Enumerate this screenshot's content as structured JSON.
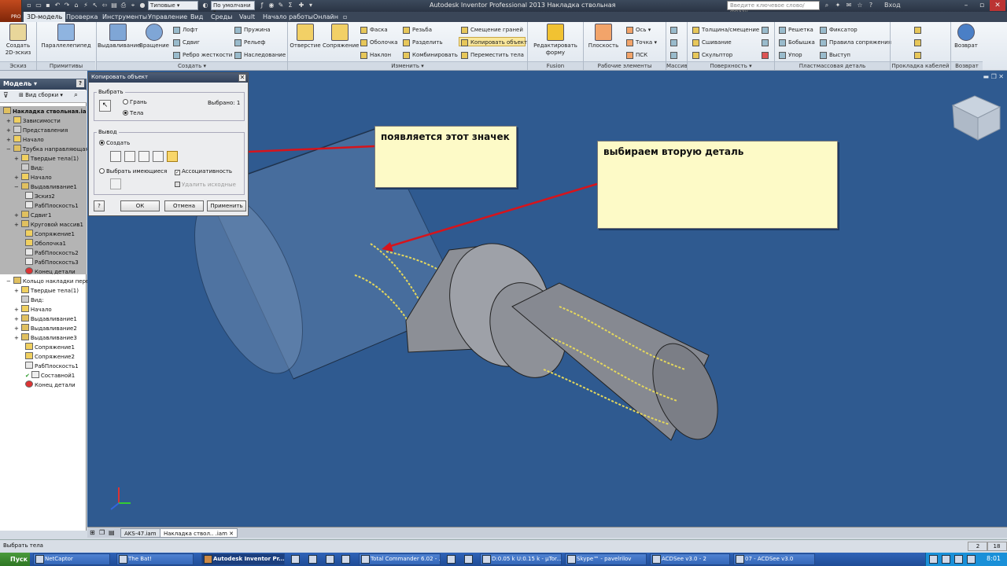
{
  "window": {
    "title": "Autodesk Inventor Professional 2013   Накладка ствольная",
    "app_badge": "PRO",
    "search_placeholder": "Введите ключевое слово/фразу",
    "login": "Вход"
  },
  "quick_access": {
    "style_select": "Типовые",
    "view_select": "По умолчани"
  },
  "menu_tabs": [
    "3D-модель",
    "Проверка",
    "Инструменты",
    "Управление",
    "Вид",
    "Среды",
    "Vault",
    "Начало работы",
    "Онлайн"
  ],
  "ribbon": {
    "sketch": {
      "create_2d_sketch": "Создать 2D-эскиз",
      "label": "Эскиз"
    },
    "primitives": {
      "box": "Параллелепипед",
      "label": "Примитивы"
    },
    "create": {
      "extrude": "Выдавливание",
      "revolve": "Вращение",
      "loft": "Лофт",
      "sweep": "Сдвиг",
      "rib": "Ребро жесткости",
      "coil": "Пружина",
      "emboss": "Рельеф",
      "derive": "Наследование",
      "label": "Создать"
    },
    "modify": {
      "hole": "Отверстие",
      "fillet": "Сопряжение",
      "chamfer": "Фаска",
      "shell": "Оболочка",
      "draft": "Наклон",
      "thread": "Резьба",
      "split": "Разделить",
      "combine": "Комбинировать",
      "offset_faces": "Смещение граней",
      "copy_object": "Копировать объект",
      "move_bodies": "Переместить тела",
      "label": "Изменить"
    },
    "fusion": {
      "edit_form": "Редактировать форму",
      "label": "Fusion"
    },
    "work_features": {
      "plane": "Плоскость",
      "axis": "Ось",
      "point": "Точка",
      "ucs": "ПСК",
      "label": "Рабочие элементы"
    },
    "pattern": {
      "label": "Массив"
    },
    "surface": {
      "thicken": "Толщина/смещение",
      "stitch": "Сшивание",
      "sculpt": "Скульптор",
      "label": "Поверхность"
    },
    "plastic": {
      "grill": "Решетка",
      "boss": "Бобышка",
      "rest": "Упор",
      "snap_fit": "Фиксатор",
      "rule_fillet": "Правила сопряжения",
      "lip": "Выступ",
      "label": "Пластмассовая деталь"
    },
    "harness": {
      "label": "Прокладка кабелей"
    },
    "return": {
      "button": "Возврат",
      "label": "Возврат"
    }
  },
  "browser": {
    "header": "Модель",
    "view_select": "Вид сборки",
    "items": [
      "Накладка ствольная.ia",
      "Зависимости",
      "Представления",
      "Начало",
      "Трубка направляющая",
      "Твердые тела(1)",
      "Вид:",
      "Начало",
      "Выдавливание1",
      "Эскиз2",
      "РабПлоскость1",
      "Сдвиг1",
      "Круговой массив1",
      "Сопряжение1",
      "Оболочка1",
      "РабПлоскость2",
      "РабПлоскость3",
      "Конец детали",
      "Кольцо накладки пере",
      "Твердые тела(1)",
      "Вид:",
      "Начало",
      "Выдавливание1",
      "Выдавливание2",
      "Выдавливание3",
      "Сопряжение1",
      "Сопряжение2",
      "РабПлоскость1",
      "Составной1",
      "Конец детали"
    ]
  },
  "dialog": {
    "title": "Копировать объект",
    "select_group": "Выбрать",
    "face": "Грань",
    "bodies": "Тела",
    "selected": "Выбрано: 1",
    "output_group": "Вывод",
    "create": "Создать",
    "select_existing": "Выбрать имеющиеся",
    "associative": "Ассоциативность",
    "delete_originals": "Удалить исходные",
    "ok": "ОК",
    "cancel": "Отмена",
    "apply": "Применить",
    "help": "?"
  },
  "callouts": {
    "first": "появляется этот значек",
    "second": "выбираем вторую деталь"
  },
  "doc_tabs": [
    "AKS-47.iam",
    "Накладка ствол.. .iam"
  ],
  "status": {
    "text": "Выбрать тела",
    "num1": "2",
    "num2": "18"
  },
  "taskbar": {
    "start": "Пуск",
    "items": [
      "NetCaptor",
      "The Bat!",
      "Autodesk Inventor Pr...",
      "Total Commander 6.02 - ...",
      "D:0.05 k U:0.15 k - µTor...",
      "Skype™ - pavelrilov",
      "ACDSee v3.0 - 2",
      "07 - ACDSee v3.0"
    ],
    "clock": "8:01"
  },
  "colors": {
    "viewport": "#2f5a90",
    "callout_bg": "#fdfac7",
    "arrow": "#d6141c",
    "highlight": "#f8d66a"
  }
}
